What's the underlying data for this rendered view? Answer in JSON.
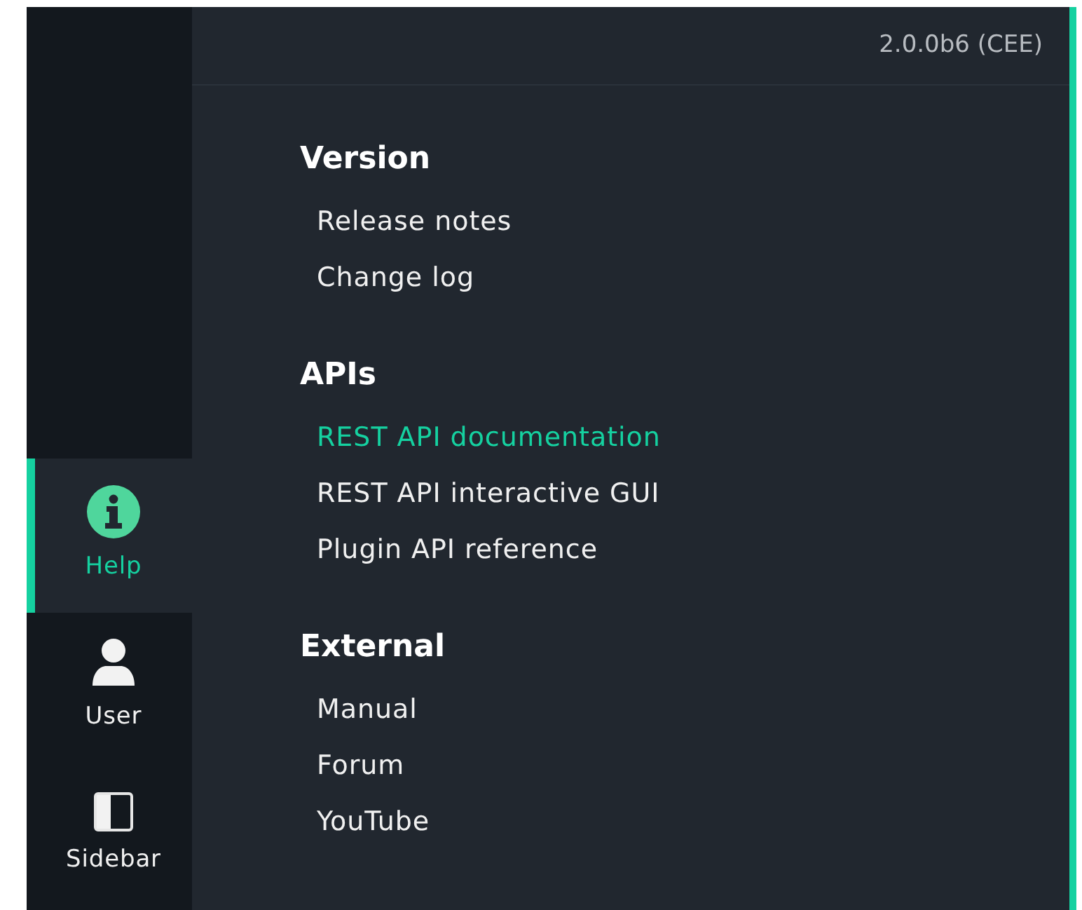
{
  "version": "2.0.0b6 (CEE)",
  "sidebar": {
    "items": [
      {
        "label": "Help",
        "selected": true
      },
      {
        "label": "User",
        "selected": false
      },
      {
        "label": "Sidebar",
        "selected": false
      }
    ]
  },
  "sections": [
    {
      "title": "Version",
      "items": [
        {
          "label": "Release notes",
          "selected": false
        },
        {
          "label": "Change log",
          "selected": false
        }
      ]
    },
    {
      "title": "APIs",
      "items": [
        {
          "label": "REST API documentation",
          "selected": true
        },
        {
          "label": "REST API interactive GUI",
          "selected": false
        },
        {
          "label": "Plugin API reference",
          "selected": false
        }
      ]
    },
    {
      "title": "External",
      "items": [
        {
          "label": "Manual",
          "selected": false
        },
        {
          "label": "Forum",
          "selected": false
        },
        {
          "label": "YouTube",
          "selected": false
        }
      ]
    }
  ]
}
